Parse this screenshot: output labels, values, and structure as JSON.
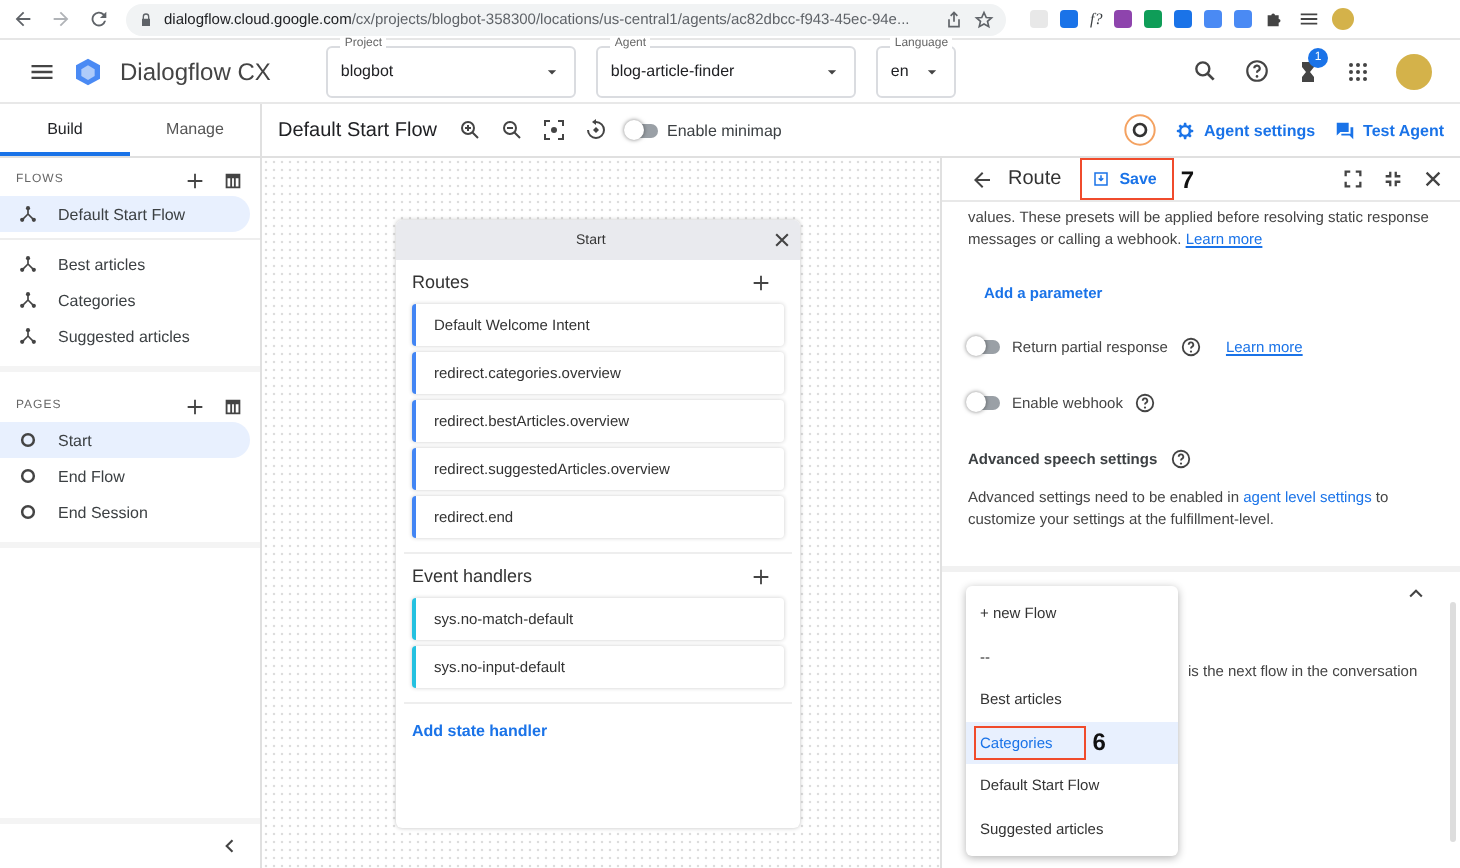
{
  "browser": {
    "url_host": "dialogflow.cloud.google.com",
    "url_path": "/cx/projects/blogbot-358300/locations/us-central1/agents/ac82dbcc-f943-45ec-94e...",
    "extension_text": "f?"
  },
  "header": {
    "product": "Dialogflow CX",
    "fields": [
      {
        "label": "Project",
        "value": "blogbot"
      },
      {
        "label": "Agent",
        "value": "blog-article-finder"
      },
      {
        "label": "Language",
        "value": "en"
      }
    ],
    "notification_count": "1"
  },
  "tabs": [
    {
      "label": "Build",
      "selected": true
    },
    {
      "label": "Manage",
      "selected": false
    }
  ],
  "toolbar": {
    "flow_title": "Default Start Flow",
    "minimap": {
      "label": "Enable minimap",
      "on": false
    },
    "agent_settings": "Agent settings",
    "test_agent": "Test Agent"
  },
  "sidebar": {
    "flows_heading": "FLOWS",
    "flows": [
      {
        "label": "Default Start Flow",
        "selected": true
      },
      {
        "label": "Best articles",
        "selected": false
      },
      {
        "label": "Categories",
        "selected": false
      },
      {
        "label": "Suggested articles",
        "selected": false
      }
    ],
    "pages_heading": "PAGES",
    "pages": [
      {
        "label": "Start",
        "selected": true
      },
      {
        "label": "End Flow",
        "selected": false
      },
      {
        "label": "End Session",
        "selected": false
      }
    ]
  },
  "page_card": {
    "title": "Start",
    "routes_heading": "Routes",
    "routes": [
      "Default Welcome Intent",
      "redirect.categories.overview",
      "redirect.bestArticles.overview",
      "redirect.suggestedArticles.overview",
      "redirect.end"
    ],
    "events_heading": "Event handlers",
    "events": [
      "sys.no-match-default",
      "sys.no-input-default"
    ],
    "add_handler": "Add state handler"
  },
  "route_panel": {
    "title": "Route",
    "save": {
      "label": "Save",
      "callout": "7"
    },
    "preset_text": [
      "values. These presets will be applied before resolving static response",
      "messages or calling a webhook."
    ],
    "preset_link": "Learn more",
    "add_parameter": "Add a parameter",
    "toggles": [
      {
        "label": "Return partial response",
        "on": false,
        "link": "Learn more"
      },
      {
        "label": "Enable webhook",
        "on": false
      }
    ],
    "speech_heading": "Advanced speech settings",
    "speech_text_before": "Advanced settings need to be enabled in",
    "speech_link": "agent level settings",
    "speech_text_after": "to customize your settings at the fulfillment-level.",
    "transition_hint": "is the next flow in the conversation"
  },
  "flow_dropdown": [
    {
      "label": "+ new Flow",
      "selected": false
    },
    {
      "label": "--",
      "selected": false
    },
    {
      "label": "Best articles",
      "selected": false
    },
    {
      "label": "Categories",
      "selected": true,
      "callout": "6"
    },
    {
      "label": "Default Start Flow",
      "selected": false
    },
    {
      "label": "Suggested articles",
      "selected": false
    }
  ]
}
